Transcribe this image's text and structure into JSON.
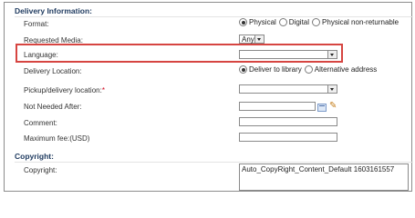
{
  "delivery": {
    "section_title": "Delivery Information:",
    "format": {
      "label": "Format:",
      "options": [
        "Physical",
        "Digital",
        "Physical non-returnable"
      ],
      "selected": "Physical"
    },
    "requested_media": {
      "label": "Requested Media:",
      "value": "Any"
    },
    "language": {
      "label": "Language:",
      "value": ""
    },
    "delivery_location": {
      "label": "Delivery Location:",
      "options": [
        "Deliver to library",
        "Alternative address"
      ],
      "selected": "Deliver to library"
    },
    "pickup_location": {
      "label": "Pickup/delivery location:",
      "required_mark": "*",
      "value": ""
    },
    "not_needed_after": {
      "label": "Not Needed After:",
      "value": ""
    },
    "comment": {
      "label": "Comment:",
      "value": ""
    },
    "maximum_fee": {
      "label": "Maximum fee:(USD)",
      "value": ""
    }
  },
  "copyright": {
    "section_title": "Copyright:",
    "label": "Copyright:",
    "value": "Auto_CopyRight_Content_Default 1603161557"
  },
  "colors": {
    "highlight": "#d64541",
    "section_title": "#1e3a5f"
  },
  "icons": {
    "calendar": "calendar-icon",
    "clear": "eraser-icon"
  }
}
